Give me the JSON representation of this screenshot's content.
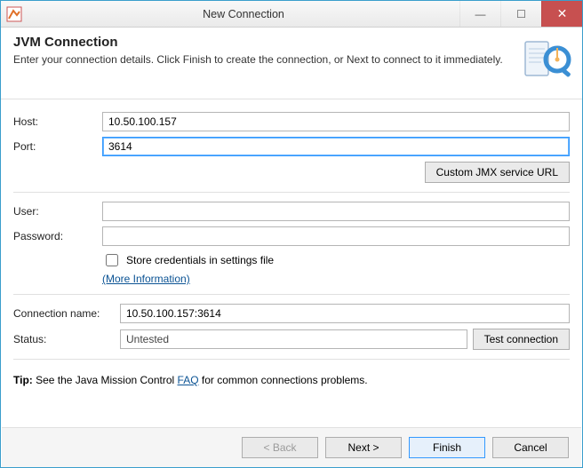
{
  "window": {
    "title": "New Connection"
  },
  "header": {
    "title": "JVM Connection",
    "subtitle": "Enter your connection details. Click Finish to create the connection, or Next to connect to it immediately."
  },
  "fields": {
    "host_label": "Host:",
    "host_value": "10.50.100.157",
    "port_label": "Port:",
    "port_value": "3614",
    "custom_url_btn": "Custom JMX service URL",
    "user_label": "User:",
    "user_value": "",
    "password_label": "Password:",
    "password_value": "",
    "store_creds_label": "Store credentials in settings file",
    "store_creds_checked": false,
    "more_info_link": "(More Information)",
    "connection_name_label": "Connection name:",
    "connection_name_value": "10.50.100.157:3614",
    "status_label": "Status:",
    "status_value": "Untested",
    "test_btn": "Test connection"
  },
  "tip": {
    "prefix": "Tip: ",
    "text1": "See the Java Mission Control ",
    "link": "FAQ",
    "text2": " for common connections problems."
  },
  "buttons": {
    "back": "< Back",
    "next": "Next >",
    "finish": "Finish",
    "cancel": "Cancel"
  }
}
